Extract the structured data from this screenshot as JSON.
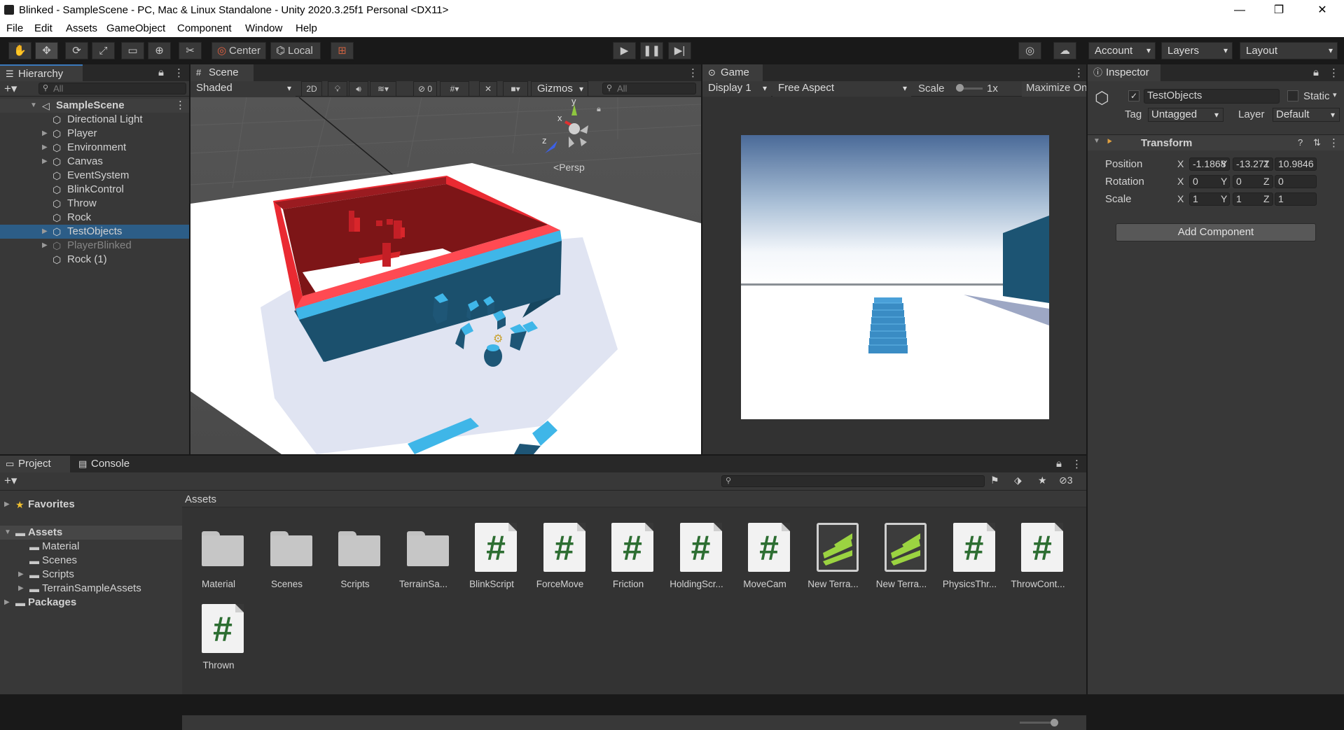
{
  "window": {
    "title": "Blinked - SampleScene - PC, Mac & Linux Standalone - Unity 2020.3.25f1 Personal <DX11>"
  },
  "menu": [
    "File",
    "Edit",
    "Assets",
    "GameObject",
    "Component",
    "Window",
    "Help"
  ],
  "toolbar": {
    "pivot": "Center",
    "space": "Local",
    "account": "Account",
    "layers": "Layers",
    "layout": "Layout"
  },
  "hierarchy": {
    "tab": "Hierarchy",
    "search_placeholder": "All",
    "scene": "SampleScene",
    "items": [
      {
        "label": "Directional Light",
        "expandable": false,
        "selected": false,
        "disabled": false
      },
      {
        "label": "Player",
        "expandable": true,
        "selected": false,
        "disabled": false
      },
      {
        "label": "Environment",
        "expandable": true,
        "selected": false,
        "disabled": false
      },
      {
        "label": "Canvas",
        "expandable": true,
        "selected": false,
        "disabled": false
      },
      {
        "label": "EventSystem",
        "expandable": false,
        "selected": false,
        "disabled": false
      },
      {
        "label": "BlinkControl",
        "expandable": false,
        "selected": false,
        "disabled": false
      },
      {
        "label": "Throw",
        "expandable": false,
        "selected": false,
        "disabled": false
      },
      {
        "label": "Rock",
        "expandable": false,
        "selected": false,
        "disabled": false
      },
      {
        "label": "TestObjects",
        "expandable": true,
        "selected": true,
        "disabled": false
      },
      {
        "label": "PlayerBlinked",
        "expandable": true,
        "selected": false,
        "disabled": true
      },
      {
        "label": "Rock (1)",
        "expandable": false,
        "selected": false,
        "disabled": false
      }
    ]
  },
  "scene": {
    "tab": "Scene",
    "shading": "Shaded",
    "mode2d": "2D",
    "hidden_count": "0",
    "gizmos": "Gizmos",
    "search_placeholder": "All",
    "persp": "Persp",
    "axis_y": "y",
    "axis_x": "x",
    "axis_z": "z"
  },
  "game": {
    "tab": "Game",
    "display": "Display 1",
    "aspect": "Free Aspect",
    "scale_label": "Scale",
    "scale_value": "1x",
    "maximize": "Maximize On Play"
  },
  "inspector": {
    "tab": "Inspector",
    "object_name": "TestObjects",
    "static_label": "Static",
    "tag_label": "Tag",
    "tag_value": "Untagged",
    "layer_label": "Layer",
    "layer_value": "Default",
    "component": "Transform",
    "rows": [
      {
        "label": "Position",
        "x": "-1.1868",
        "y": "-13.271",
        "z": "10.9846"
      },
      {
        "label": "Rotation",
        "x": "0",
        "y": "0",
        "z": "0"
      },
      {
        "label": "Scale",
        "x": "1",
        "y": "1",
        "z": "1"
      }
    ],
    "axes": {
      "x": "X",
      "y": "Y",
      "z": "Z"
    },
    "add_component": "Add Component"
  },
  "project": {
    "tab": "Project",
    "console_tab": "Console",
    "hidden_count": "3",
    "breadcrumb": "Assets",
    "tree": [
      {
        "label": "Favorites",
        "level": 0,
        "bold": true,
        "icon": "star-icon"
      },
      {
        "label": "Assets",
        "level": 0,
        "bold": true,
        "icon": "folder-open-icon"
      },
      {
        "label": "Material",
        "level": 1,
        "bold": false,
        "icon": "folder-icon"
      },
      {
        "label": "Scenes",
        "level": 1,
        "bold": false,
        "icon": "folder-icon"
      },
      {
        "label": "Scripts",
        "level": 1,
        "bold": false,
        "icon": "folder-icon"
      },
      {
        "label": "TerrainSampleAssets",
        "level": 1,
        "bold": false,
        "icon": "folder-icon"
      },
      {
        "label": "Packages",
        "level": 0,
        "bold": true,
        "icon": "folder-icon"
      }
    ],
    "assets": [
      {
        "label": "Material",
        "kind": "folder"
      },
      {
        "label": "Scenes",
        "kind": "folder"
      },
      {
        "label": "Scripts",
        "kind": "folder"
      },
      {
        "label": "TerrainSa...",
        "kind": "folder"
      },
      {
        "label": "BlinkScript",
        "kind": "script"
      },
      {
        "label": "ForceMove",
        "kind": "script"
      },
      {
        "label": "Friction",
        "kind": "script"
      },
      {
        "label": "HoldingScr...",
        "kind": "script"
      },
      {
        "label": "MoveCam",
        "kind": "script"
      },
      {
        "label": "New Terra...",
        "kind": "terrain"
      },
      {
        "label": "New Terra...",
        "kind": "terrain"
      },
      {
        "label": "PhysicsThr...",
        "kind": "script"
      },
      {
        "label": "ThrowCont...",
        "kind": "script"
      },
      {
        "label": "Thrown",
        "kind": "script"
      }
    ]
  },
  "colors": {
    "selection": "#2c5d87",
    "accent_red": "#d9262b",
    "accent_blue": "#3fb6e8",
    "script_green": "#2d6e32"
  }
}
